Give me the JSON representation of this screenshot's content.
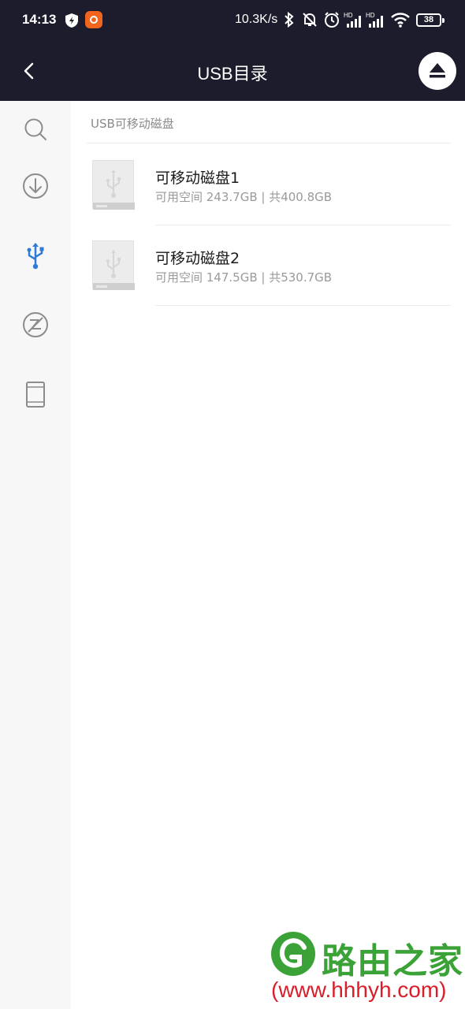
{
  "status_bar": {
    "time": "14:13",
    "net_speed": "10.3K/s",
    "battery": "38",
    "icons": [
      "bluetooth-icon",
      "mute-bell-icon",
      "alarm-icon",
      "hd-signal-icon",
      "hd-signal-icon",
      "wifi-icon"
    ]
  },
  "app_bar": {
    "title": "USB目录",
    "back_icon": "chevron-left-icon",
    "eject_icon": "eject-icon"
  },
  "sidebar": {
    "items": [
      {
        "icon": "search-icon",
        "active": false
      },
      {
        "icon": "download-icon",
        "active": false
      },
      {
        "icon": "usb-icon",
        "active": true
      },
      {
        "icon": "blocked-icon",
        "active": false
      },
      {
        "icon": "tablet-icon",
        "active": false
      }
    ],
    "accent_color": "#2f7ad6"
  },
  "main": {
    "section_label": "USB可移动磁盘",
    "disks": [
      {
        "name": "可移动磁盘1",
        "info": "可用空间 243.7GB | 共400.8GB"
      },
      {
        "name": "可移动磁盘2",
        "info": "可用空间 147.5GB | 共530.7GB"
      }
    ]
  },
  "watermark": {
    "title": "路由之家",
    "url": "(www.hhhyh.com)",
    "title_color": "#3aa236",
    "url_color": "#d81e2a"
  }
}
